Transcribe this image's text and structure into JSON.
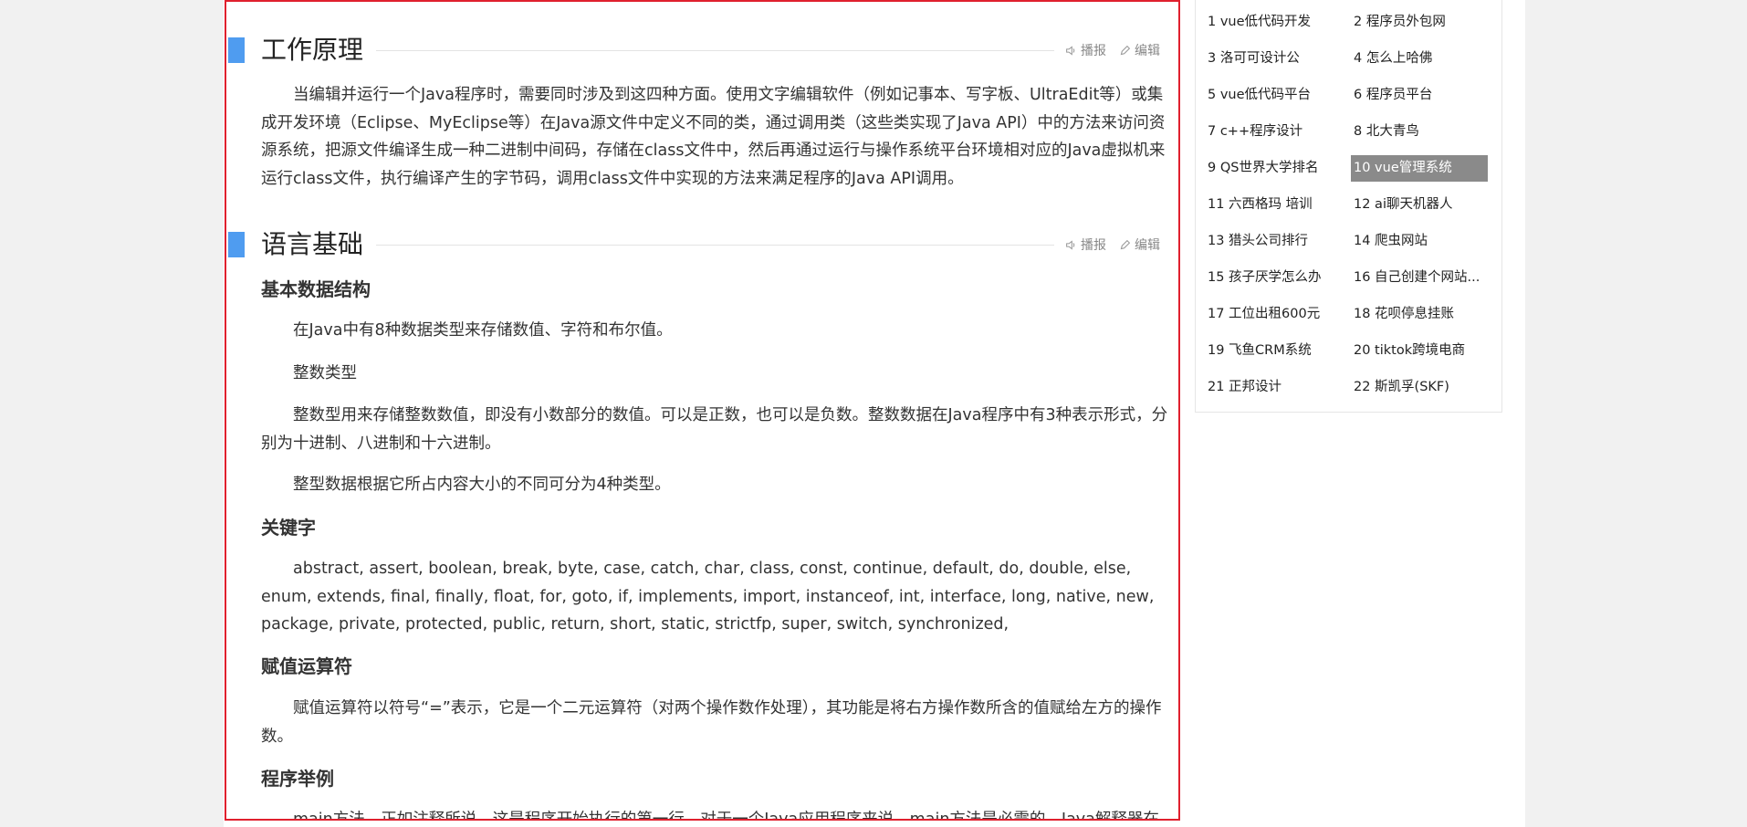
{
  "sections": [
    {
      "title": "工作原理",
      "tool_broadcast": "播报",
      "tool_edit": "编辑"
    },
    {
      "title": "语言基础",
      "tool_broadcast": "播报",
      "tool_edit": "编辑"
    }
  ],
  "working_principle_text": "当编辑并运行一个Java程序时，需要同时涉及到这四种方面。使用文字编辑软件（例如记事本、写字板、UltraEdit等）或集成开发环境（Eclipse、MyEclipse等）在Java源文件中定义不同的类，通过调用类（这些类实现了Java API）中的方法来访问资源系统，把源文件编译生成一种二进制中间码，存储在class文件中，然后再通过运行与操作系统平台环境相对应的Java虚拟机来运行class文件，执行编译产生的字节码，调用class文件中实现的方法来满足程序的Java API调用。",
  "basic_data_heading": "基本数据结构",
  "basic_data_p1": "在Java中有8种数据类型来存储数值、字符和布尔值。",
  "basic_data_p2": "整数类型",
  "basic_data_p3": "整数型用来存储整数数值，即没有小数部分的数值。可以是正数，也可以是负数。整数数据在Java程序中有3种表示形式，分别为十进制、八进制和十六进制。",
  "basic_data_p4": "整型数据根据它所占内容大小的不同可分为4种类型。",
  "keywords_heading": "关键字",
  "keywords_text": "abstract, assert, boolean, break, byte, case, catch, char, class, const, continue, default, do, double, else, enum, extends, final, finally, float, for, goto, if, implements, import, instanceof, int, interface, long, native, new, package, private, protected, public, return, short, static, strictfp, super, switch, synchronized,",
  "assignment_heading": "赋值运算符",
  "assignment_text": "赋值运算符以符号“=”表示，它是一个二元运算符（对两个操作数作处理），其功能是将右方操作数所含的值赋给左方的操作数。",
  "example_heading": "程序举例",
  "example_text": "main方法，正如注释所说，这是程序开始执行的第一行。对于一个Java应用程序来说，main方法是必需的，Java解释器在",
  "hot_list": [
    "1 vue低代码开发",
    "2 程序员外包网",
    "3 洛可可设计公",
    "4 怎么上哈佛",
    "5 vue低代码平台",
    "6 程序员平台",
    "7 c++程序设计",
    "8 北大青鸟",
    "9 QS世界大学排名",
    "10 vue管理系统",
    "11 六西格玛 培训",
    "12 ai聊天机器人",
    "13 猎头公司排行",
    "14 爬虫网站",
    "15 孩子厌学怎么办",
    "16 自己创建个网站...",
    "17 工位出租600元",
    "18 花呗停息挂账",
    "19 飞鱼CRM系统",
    "20 tiktok跨境电商",
    "21 正邦设计",
    "22 斯凯孚(SKF)"
  ],
  "active_hot_index": 9,
  "colors": {
    "accent_bar": "#4f9cf0",
    "frame_border": "#e0202e",
    "active_item_bg": "#8a8a8a"
  }
}
